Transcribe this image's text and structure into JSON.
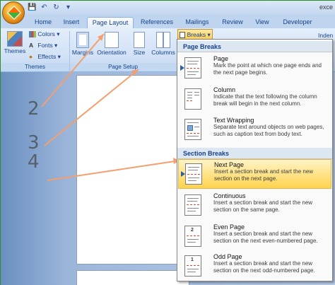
{
  "title_fragment": "exce",
  "tabs": [
    "Home",
    "Insert",
    "Page Layout",
    "References",
    "Mailings",
    "Review",
    "View",
    "Developer"
  ],
  "active_tab": "Page Layout",
  "ribbon": {
    "themes": {
      "themes_label": "Themes",
      "colors_label": "Colors",
      "fonts_label": "Fonts",
      "effects_label": "Effects",
      "group_label": "Themes"
    },
    "page_setup": {
      "margins_label": "Margins",
      "orientation_label": "Orientation",
      "size_label": "Size",
      "columns_label": "Columns",
      "breaks_label": "Breaks",
      "group_label": "Page Setup"
    },
    "right_label": "Inden"
  },
  "annotations": [
    "2",
    "3",
    "4"
  ],
  "menu": {
    "page_breaks_header": "Page Breaks",
    "section_breaks_header": "Section Breaks",
    "page_breaks": [
      {
        "name": "Page",
        "description": "Mark the point at which one page ends and the next page begins."
      },
      {
        "name": "Column",
        "description": "Indicate that the text following the column break will begin in the next column."
      },
      {
        "name": "Text Wrapping",
        "description": "Separate text around objects on web pages, such as caption text from body text."
      }
    ],
    "section_breaks": [
      {
        "name": "Next Page",
        "description": "Insert a section break and start the new section on the next page."
      },
      {
        "name": "Continuous",
        "description": "Insert a section break and start the new section on the same page."
      },
      {
        "name": "Even Page",
        "description": "Insert a section break and start the new section on the next even-numbered page.",
        "icon_number": "2"
      },
      {
        "name": "Odd Page",
        "description": "Insert a section break and start the new section on the next odd-numbered page.",
        "icon_number": "1"
      }
    ]
  },
  "highlight_color": "#ffe283",
  "annotation_arrow_color": "#f3a06e"
}
